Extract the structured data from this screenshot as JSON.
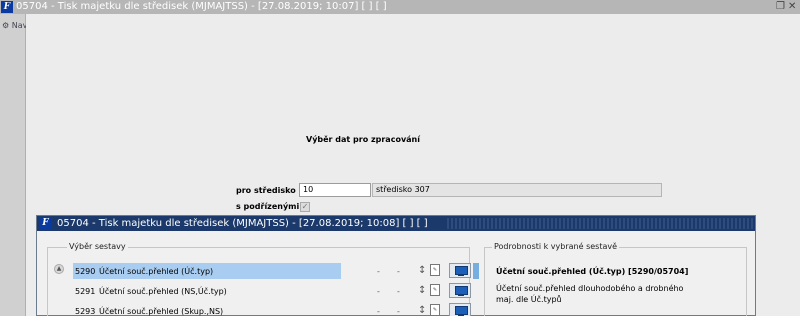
{
  "window": {
    "title": "05704 - Tisk  majetku dle středisek (MJMAJTSS) - [27.08.2019; 10:07]  [ ]  [ ]",
    "logo_label": "F",
    "restore_icon": "restore-icon",
    "close_glyph": "✕"
  },
  "sidebar": {
    "nav_label": "Nav",
    "nav_icon": "nav-icon"
  },
  "form": {
    "heading": "Výběr dat pro zpracování",
    "stredisko_label": "pro středisko",
    "stredisko_code": "10",
    "stredisko_name": "středisko 307",
    "podrizenymi_label": "s podřízenými",
    "podrizenymi_checked": true
  },
  "dialog": {
    "title": "05704 - Tisk  majetku dle středisek (MJMAJTSS) - [27.08.2019; 10:08]  [ ]  [ ]",
    "logo_label": "F",
    "group_left_legend": "Výběr sestavy",
    "group_right_legend": "Podrobnosti k vybrané sestavě",
    "rows": [
      {
        "num": "5290",
        "name": "Účetní souč.přehled (Úč.typ)",
        "selected": true
      },
      {
        "num": "5291",
        "name": "Účetní souč.přehled (NS,Úč.typ)",
        "selected": false
      },
      {
        "num": "5293",
        "name": "Účetní souč.přehled (Skup.,NS)",
        "selected": false
      }
    ],
    "row_dash": "-",
    "detail_title": "Účetní souč.přehled (Úč.typ) [5290/05704]",
    "detail_desc": "Účetní souč.přehled dlouhodobého a drobného maj. dle Úč.typů"
  },
  "colors": {
    "titlebar": "#b6b6b6",
    "dialog_titlebar": "#1b3a6b",
    "selection": "#a9cdf0",
    "accent": "#1c5fb8"
  }
}
